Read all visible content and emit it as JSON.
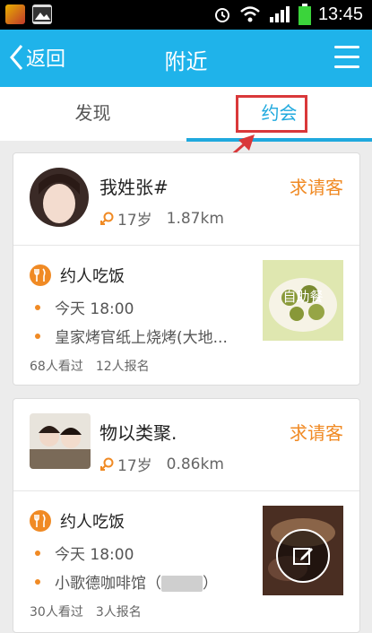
{
  "status_bar": {
    "time": "13:45"
  },
  "nav": {
    "back_label": "返回",
    "title": "附近"
  },
  "tabs": [
    {
      "label": "发现"
    },
    {
      "label": "约会"
    }
  ],
  "cards": [
    {
      "username": "我姓张#",
      "age": "17岁",
      "distance": "1.87km",
      "treat_label": "求请客",
      "event_title": "约人吃饭",
      "time": "今天 18:00",
      "place": "皇家烤官纸上烧烤(大地...",
      "views": "68人看过",
      "signups": "12人报名",
      "photo_overlay": "自助餐"
    },
    {
      "username": "物以类聚.",
      "age": "17岁",
      "distance": "0.86km",
      "treat_label": "求请客",
      "event_title": "约人吃饭",
      "time": "今天 18:00",
      "place": "小歌德咖啡馆（",
      "place_end": "）",
      "views": "30人看过",
      "signups": "3人报名"
    }
  ],
  "colors": {
    "accent": "#1fb3ea",
    "tab_active": "#1fa9de",
    "orange": "#f08a24",
    "annotation": "#d9383a"
  }
}
